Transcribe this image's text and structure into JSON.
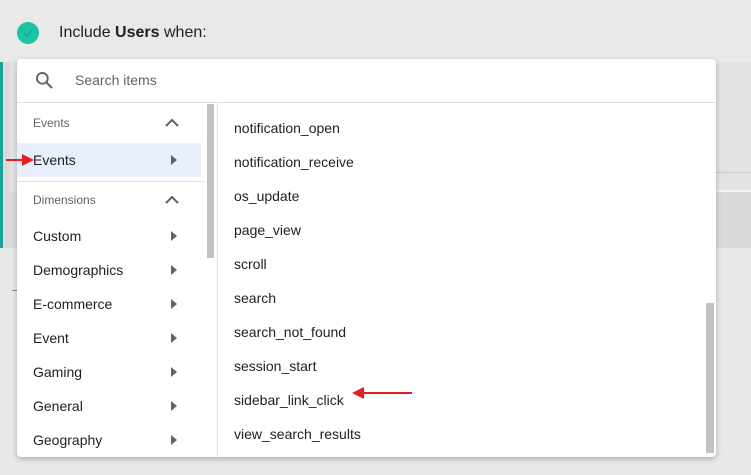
{
  "header": {
    "prefix": "Include",
    "bold": "Users",
    "suffix": "when:"
  },
  "search": {
    "placeholder": "Search items"
  },
  "left": {
    "section1": {
      "label": "Events"
    },
    "selected_item": {
      "label": "Events"
    },
    "section2": {
      "label": "Dimensions"
    },
    "items": [
      {
        "label": "Custom"
      },
      {
        "label": "Demographics"
      },
      {
        "label": "E-commerce"
      },
      {
        "label": "Event"
      },
      {
        "label": "Gaming"
      },
      {
        "label": "General"
      },
      {
        "label": "Geography"
      }
    ]
  },
  "right": {
    "items": [
      {
        "label": "notification_open"
      },
      {
        "label": "notification_receive"
      },
      {
        "label": "os_update"
      },
      {
        "label": "page_view"
      },
      {
        "label": "scroll"
      },
      {
        "label": "search"
      },
      {
        "label": "search_not_found"
      },
      {
        "label": "session_start"
      },
      {
        "label": "sidebar_link_click"
      },
      {
        "label": "view_search_results"
      }
    ]
  },
  "colors": {
    "accent": "#1ec2a4",
    "selected_bg": "#e8eefb",
    "annotation": "#e81c1c"
  }
}
